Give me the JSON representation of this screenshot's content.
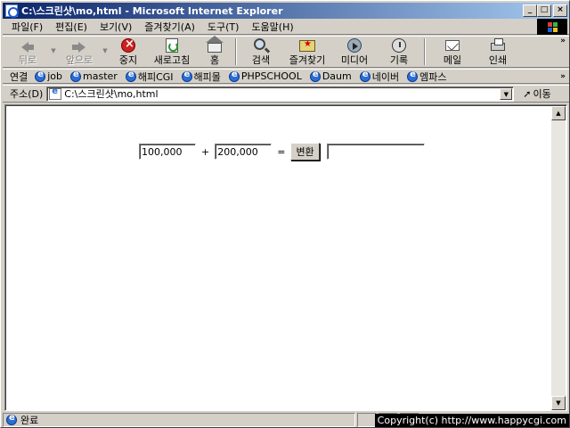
{
  "window": {
    "title": "C:\\스크린샷\\mo,html - Microsoft Internet Explorer",
    "minimize": "_",
    "maximize": "□",
    "close": "×"
  },
  "menu": [
    "파일(F)",
    "편집(E)",
    "보기(V)",
    "즐겨찾기(A)",
    "도구(T)",
    "도움말(H)"
  ],
  "toolbar": {
    "back": "뒤로",
    "forward": "앞으로",
    "stop": "중지",
    "refresh": "새로고침",
    "home": "홈",
    "search": "검색",
    "favorites": "즐겨찾기",
    "media": "미디어",
    "history": "기록",
    "mail": "메일",
    "print": "인쇄",
    "more": "»"
  },
  "links": {
    "label": "연결",
    "items": [
      "job",
      "master",
      "해피CGI",
      "해피몰",
      "PHPSCHOOL",
      "Daum",
      "네이버",
      "엠파스"
    ],
    "more": "»"
  },
  "address": {
    "label": "주소(D)",
    "value": "C:\\스크린샷\\mo,html",
    "go": "이동"
  },
  "form": {
    "value1": "100,000",
    "plus": "+",
    "value2": "200,000",
    "equals": "=",
    "convert_button": "변환",
    "result": ""
  },
  "status": {
    "text": "완료",
    "copyright": "Copyright(c) http://www.happycgi.com"
  }
}
